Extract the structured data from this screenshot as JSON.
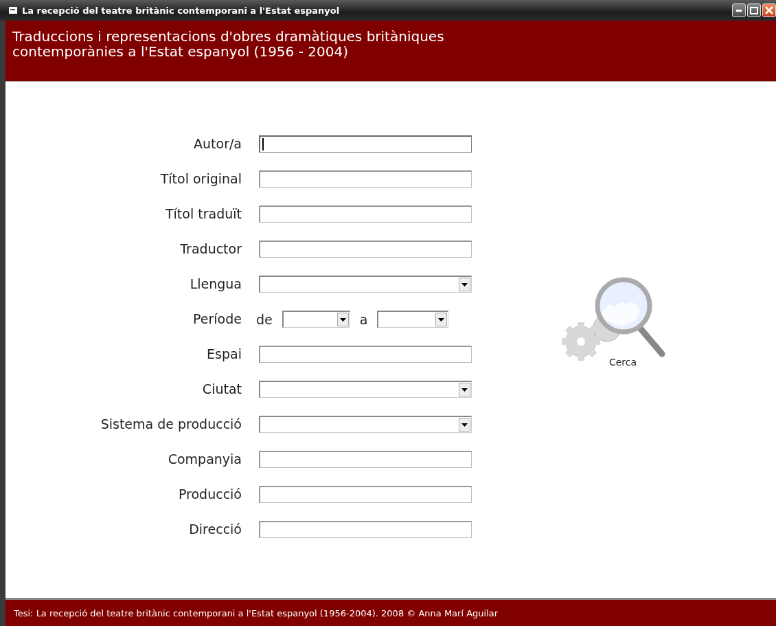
{
  "window": {
    "title": "La recepció del teatre britànic contemporani a l'Estat espanyol"
  },
  "header": {
    "lines": [
      "Traduccions i representacions d'obres dramàtiques britàniques",
      "contemporànies a l'Estat espanyol (1956 - 2004)"
    ]
  },
  "fields": [
    {
      "kind": "text",
      "label": "Autor/a",
      "focused": true
    },
    {
      "kind": "text",
      "label": "Títol original",
      "focused": false
    },
    {
      "kind": "text",
      "label": "Títol traduït",
      "focused": false
    },
    {
      "kind": "text",
      "label": "Traductor",
      "focused": false
    },
    {
      "kind": "select",
      "label": "Llengua"
    },
    {
      "kind": "period",
      "label": "Període",
      "from_label": "de",
      "to_label": "a"
    },
    {
      "kind": "text",
      "label": "Espai",
      "focused": false
    },
    {
      "kind": "select",
      "label": "Ciutat"
    },
    {
      "kind": "select",
      "label": "Sistema de producció"
    },
    {
      "kind": "text",
      "label": "Companyia",
      "focused": false
    },
    {
      "kind": "text",
      "label": "Producció",
      "focused": false
    },
    {
      "kind": "text",
      "label": "Direcció",
      "focused": false
    }
  ],
  "search_button": {
    "label": "Cerca"
  },
  "footer": {
    "text": "Tesi: La recepció del teatre britànic contemporani a l'Estat espanyol (1956-2004). 2008 © Anna Marí Aguilar"
  }
}
